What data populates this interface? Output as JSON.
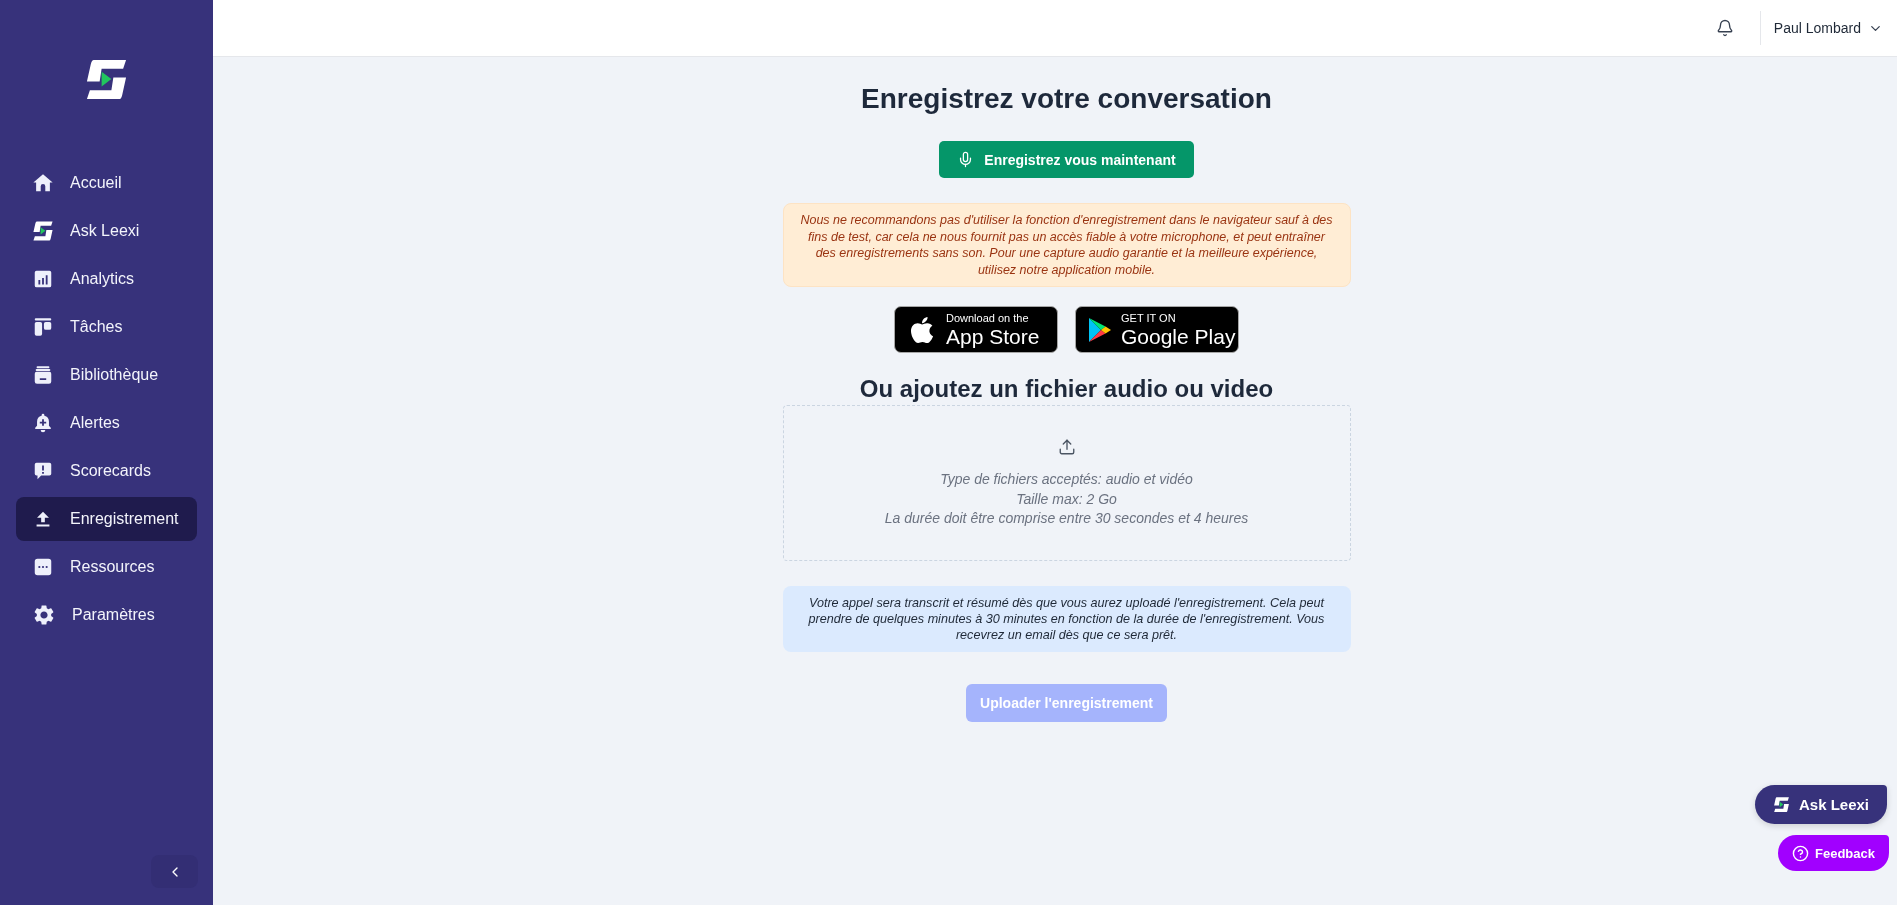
{
  "sidebar": {
    "items": [
      {
        "label": "Accueil",
        "selected": false
      },
      {
        "label": "Ask Leexi",
        "selected": false
      },
      {
        "label": "Analytics",
        "selected": false
      },
      {
        "label": "Tâches",
        "selected": false
      },
      {
        "label": "Bibliothèque",
        "selected": false
      },
      {
        "label": "Alertes",
        "selected": false
      },
      {
        "label": "Scorecards",
        "selected": false
      },
      {
        "label": "Enregistrement",
        "selected": true
      },
      {
        "label": "Ressources",
        "selected": false
      },
      {
        "label": "Paramètres",
        "selected": false
      }
    ]
  },
  "header": {
    "user_name": "Paul Lombard"
  },
  "main": {
    "title": "Enregistrez votre conversation",
    "record_button": {
      "label": "Enregistrez vous maintenant"
    },
    "warning": "Nous ne recommandons pas d'utiliser la fonction d'enregistrement dans le navigateur sauf à des fins de test, car cela ne nous fournit pas un accès fiable à votre microphone, et peut entraîner des enregistrements sans son. Pour une capture audio garantie et la meilleure expérience, utilisez notre application mobile.",
    "store_badges": [
      {
        "kind": "apple",
        "caption": "Download on the",
        "name": "App Store"
      },
      {
        "kind": "google",
        "caption": "GET IT ON",
        "name": "Google Play"
      }
    ],
    "upload_title": "Ou ajoutez un fichier audio ou video",
    "dropzone": {
      "lines": [
        "Type de fichiers acceptés: audio et vidéo",
        "Taille max: 2 Go",
        "La durée doit être comprise entre 30 secondes et 4 heures"
      ]
    },
    "info": "Votre appel sera transcrit et résumé dès que vous aurez uploadé l'enregistrement. Cela peut prendre de quelques minutes à 30 minutes en fonction de la durée de l'enregistrement. Vous recevrez un email dès que ce sera prêt.",
    "upload_button": {
      "label": "Uploader l'enregistrement",
      "disabled": true
    }
  },
  "floating": {
    "ask_button": {
      "label": "Ask Leexi"
    },
    "feedback_button": {
      "label": "Feedback"
    }
  }
}
